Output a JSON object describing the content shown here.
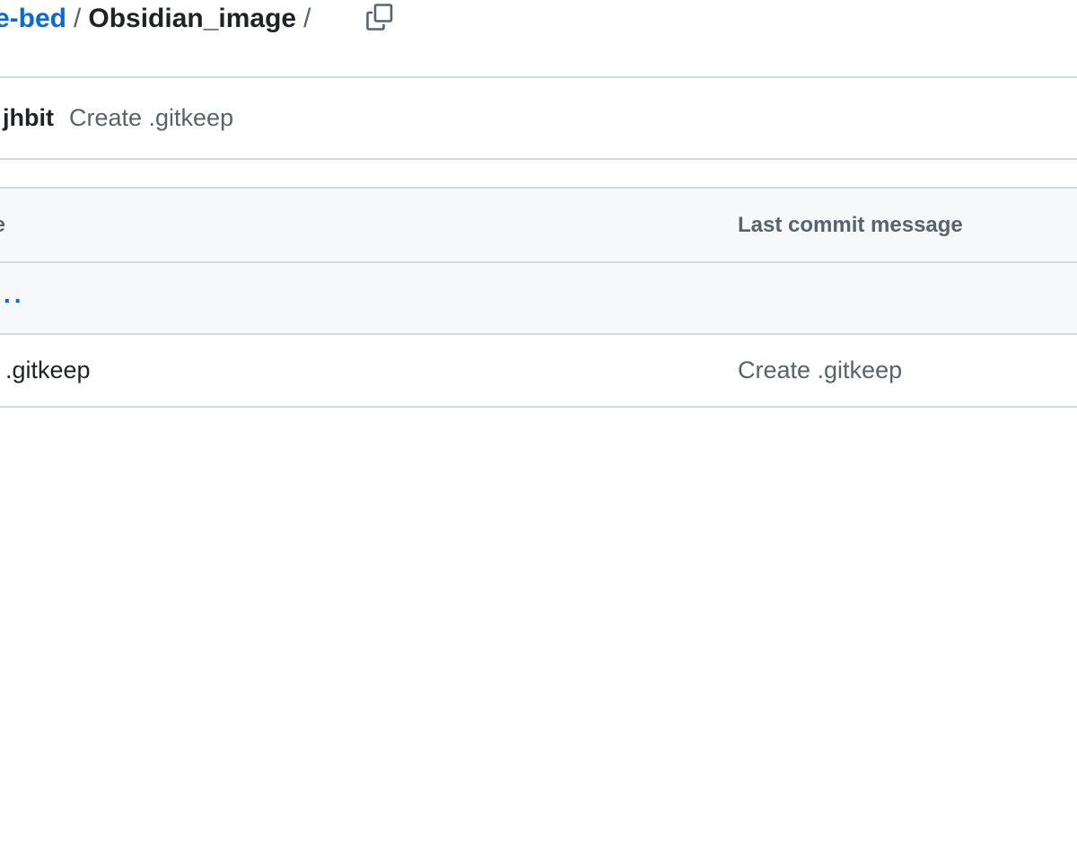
{
  "breadcrumb": {
    "repo_link": "e-bed",
    "separator": "/",
    "current_folder": "Obsidian_image",
    "trailing_separator": "/",
    "copy_icon": "copy-icon"
  },
  "latest_commit": {
    "author": "jhbit",
    "message": "Create .gitkeep"
  },
  "file_table": {
    "columns": {
      "name": "ne",
      "last_commit_message": "Last commit message"
    },
    "parent_dir": "..",
    "files": [
      {
        "name": ".gitkeep",
        "commit_message": "Create .gitkeep"
      }
    ]
  },
  "colors": {
    "link": "#0969da",
    "text_primary": "#1f2328",
    "text_muted": "#59636e",
    "border": "#d1d9e0",
    "header_bg": "#f6f8fa"
  }
}
